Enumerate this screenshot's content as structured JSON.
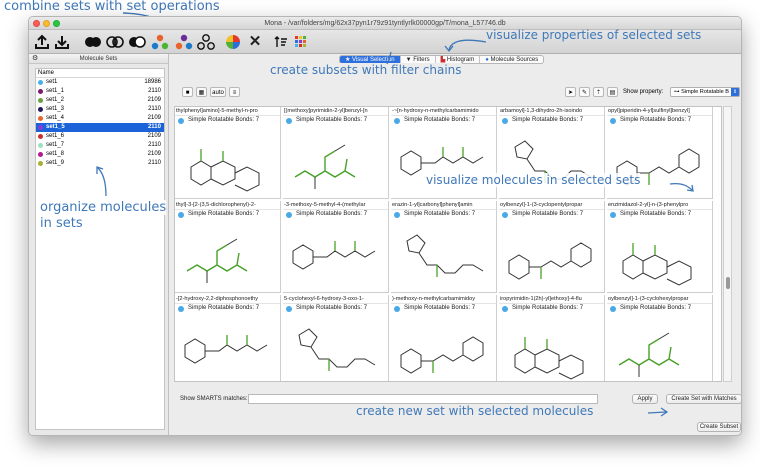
{
  "window": {
    "title": "Mona - /var/folders/mg/62x37pyn1r79z91tyntlyrlk00000gp/T/mona_L57746.db"
  },
  "annotations": {
    "combine": "combine sets with set operations",
    "visualize_props": "visualize properties of selected sets",
    "filter_chains": "create subsets with filter chains",
    "visualize_molecules": "visualize molecules in selected sets",
    "organize": "organize molecules",
    "organize2": "in sets",
    "create_new": "create new set with selected molecules"
  },
  "sidebar": {
    "title": "Molecule Sets",
    "column_header": "Name",
    "items": [
      {
        "name": "set1",
        "count": "18986",
        "color": "#46b1e8",
        "selected": false
      },
      {
        "name": "set1_1",
        "count": "2110",
        "color": "#7a1c6e",
        "selected": false
      },
      {
        "name": "set1_2",
        "count": "2109",
        "color": "#6aa042",
        "selected": false
      },
      {
        "name": "set1_3",
        "count": "2110",
        "color": "#241a5c",
        "selected": false
      },
      {
        "name": "set1_4",
        "count": "2109",
        "color": "#e8632a",
        "selected": false
      },
      {
        "name": "set1_5",
        "count": "2110",
        "color": "#8b3ad6",
        "selected": true
      },
      {
        "name": "set1_6",
        "count": "2109",
        "color": "#c92f2f",
        "selected": false
      },
      {
        "name": "set1_7",
        "count": "2110",
        "color": "#9ce0c2",
        "selected": false
      },
      {
        "name": "set1_8",
        "count": "2109",
        "color": "#b21a8f",
        "selected": false
      },
      {
        "name": "set1_9",
        "count": "2110",
        "color": "#a8b02e",
        "selected": false
      }
    ]
  },
  "tabs": [
    {
      "label": "Visual Selection",
      "icon": "star-icon",
      "active": true
    },
    {
      "label": "Filters",
      "icon": "filter-icon",
      "active": false
    },
    {
      "label": "Histogram",
      "icon": "histogram-icon",
      "active": false
    },
    {
      "label": "Molecule Sources",
      "icon": "dot-icon",
      "active": false
    }
  ],
  "view_toolbar": {
    "auto_label": "auto",
    "show_property_label": "Show property:",
    "show_property_value": "Simple Rotatable B"
  },
  "grid": {
    "rows": [
      [
        {
          "name": "thylphenyl]amino]-5-methyl-n-pro",
          "prop": "Simple Rotatable Bonds: 7"
        },
        {
          "name": "[(methoxy]pyrimidin-2-yl]benzyl-[n",
          "prop": "Simple Rotatable Bonds: 7"
        },
        {
          "name": "-~[n-hydroxy-n-methylcarbamimido",
          "prop": "Simple Rotatable Bonds: 7"
        },
        {
          "name": "arbamoyl]-1,3-dihydro-2h-isoindo",
          "prop": "Simple Rotatable Bonds: 7"
        },
        {
          "name": "opyl]piperidin-4-yl]sulfinyl]benzyl]",
          "prop": "Simple Rotatable Bonds: 7"
        }
      ],
      [
        {
          "name": "thyl]-3-[2-(3,5-dichlorophenyl)-2-",
          "prop": "Simple Rotatable Bonds: 7"
        },
        {
          "name": "-3-methoxy-5-methyl-4-(methylar",
          "prop": "Simple Rotatable Bonds: 7"
        },
        {
          "name": "erazin-1-yl]carbonyl]phenyl]amin",
          "prop": "Simple Rotatable Bonds: 7"
        },
        {
          "name": "oylbenzyl]-1-(3-cyclopentylpropar",
          "prop": "Simple Rotatable Bonds: 7"
        },
        {
          "name": "enzimidazol-2-yl]-n-(3-phenylpro",
          "prop": "Simple Rotatable Bonds: 7"
        }
      ],
      [
        {
          "name": "-[2-hydroxy-2,2-diphosphonoethy",
          "prop": "Simple Rotatable Bonds: 7"
        },
        {
          "name": "5-cyclohexyl-6-hydroxy-3-oxo-1-",
          "prop": "Simple Rotatable Bonds: 7"
        },
        {
          "name": ")-methoxy-n-methylcarbamimidoy",
          "prop": "Simple Rotatable Bonds: 7"
        },
        {
          "name": "iropyrimidin-1(2h)-yl]ethoxy]-4-flu",
          "prop": "Simple Rotatable Bonds: 7"
        },
        {
          "name": "oylbenzyl]-1-(3-cyclohexylpropar",
          "prop": "Simple Rotatable Bonds: 7"
        }
      ]
    ]
  },
  "smarts": {
    "label": "Show SMARTS matches:",
    "value": "",
    "apply": "Apply",
    "create_with_matches": "Create Set with Matches"
  },
  "create_subset": "Create Subset"
}
